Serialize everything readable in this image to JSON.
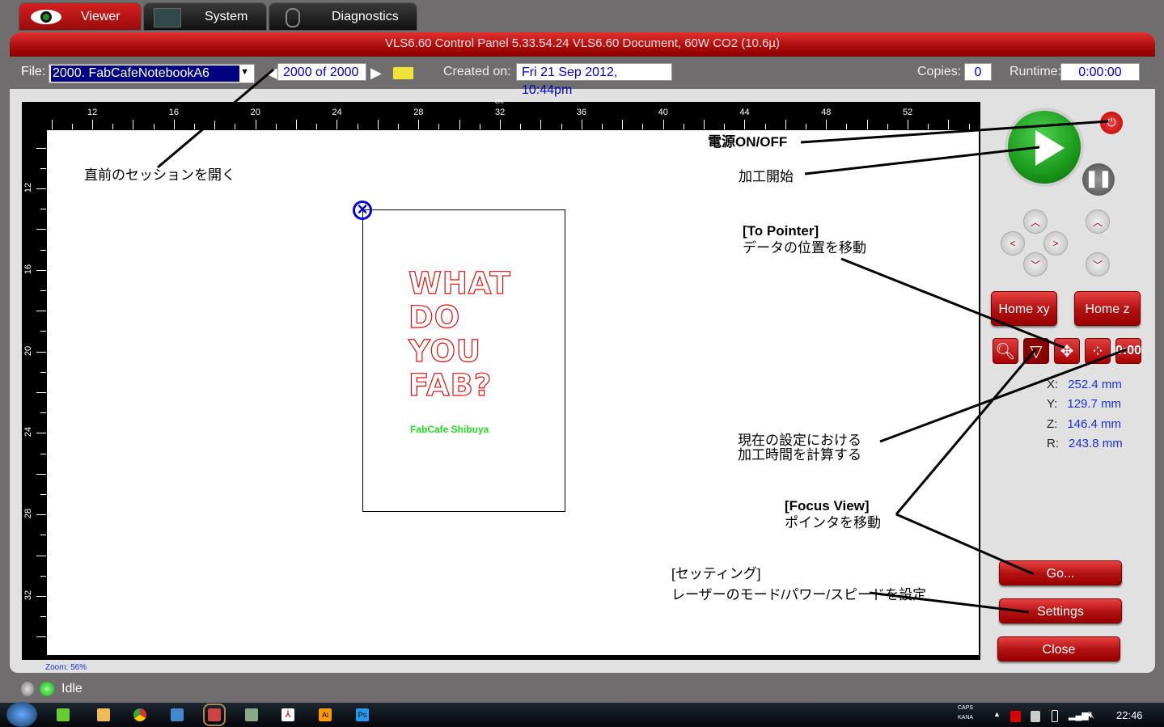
{
  "tabs": [
    {
      "label": "Viewer",
      "icon": "eye-icon"
    },
    {
      "label": "System",
      "icon": "pulse-icon"
    },
    {
      "label": "Diagnostics",
      "icon": "stethoscope-icon"
    }
  ],
  "header": {
    "title": "VLS6.60  Control Panel   5.33.54.24     VLS6.60 Document, 60W CO2 (10.6µ)"
  },
  "toolbar": {
    "file_label": "File:",
    "file_value": "2000. FabCafeNotebookA6",
    "session": "2000 of 2000",
    "created_label": "Created on:",
    "created_value": "Fri 21 Sep 2012, 10:44pm",
    "copies_label": "Copies:",
    "copies_value": "0",
    "runtime_label": "Runtime:",
    "runtime_value": "0:00:00"
  },
  "ruler": {
    "unit": "cm",
    "top": [
      "12",
      "16",
      "20",
      "24",
      "28",
      "32",
      "36",
      "40",
      "44",
      "48",
      "52"
    ],
    "left": [
      "12",
      "16",
      "20",
      "24",
      "28",
      "32"
    ]
  },
  "document": {
    "lines": [
      "WHAT",
      "DO",
      "YOU",
      "FAB?"
    ],
    "sub": "FabCafe Shibuya"
  },
  "zoom": "Zoom: 56%",
  "controls": {
    "home_xy": "Home xy",
    "home_z": "Home z",
    "time_icon_text": "0:00",
    "go": "Go...",
    "settings": "Settings",
    "close": "Close"
  },
  "coords": [
    {
      "axis": "X:",
      "value": "252.4 mm"
    },
    {
      "axis": "Y:",
      "value": "129.7 mm"
    },
    {
      "axis": "Z:",
      "value": "146.4 mm"
    },
    {
      "axis": "R:",
      "value": "243.8 mm"
    }
  ],
  "annotations": {
    "prev_session": "直前のセッションを開く",
    "power": "電源ON/OFF",
    "start": "加工開始",
    "to_pointer_title": "[To Pointer]",
    "to_pointer_desc": "データの位置を移動",
    "estimate_1": "現在の設定における",
    "estimate_2": "加工時間を計算する",
    "focus_title": "[Focus View]",
    "focus_desc": "ポインタを移動",
    "settings_title": "[セッティング]",
    "settings_desc": "レーザーのモード/パワー/スピードを設定"
  },
  "status": {
    "text": "Idle"
  },
  "taskbar": {
    "caps": "CAPS",
    "kana": "KANA",
    "time": "22:46"
  }
}
